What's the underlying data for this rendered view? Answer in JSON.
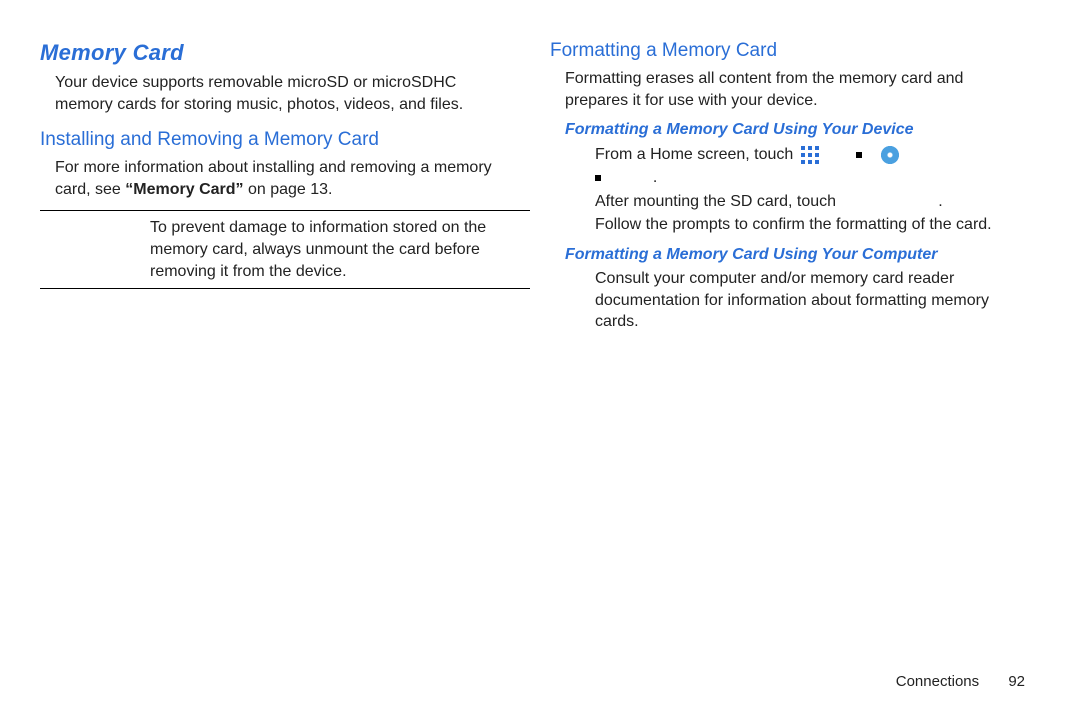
{
  "left": {
    "title": "Memory Card",
    "intro": "Your device supports removable microSD or microSDHC memory cards for storing music, photos, videos, and files.",
    "install_title": "Installing and Removing a Memory Card",
    "install_lead": "For more information about installing and removing a memory card, see ",
    "install_bold": "“Memory Card”",
    "install_tail": " on page 13.",
    "note": "To prevent damage to information stored on the memory card, always unmount the card before removing it from the device."
  },
  "right": {
    "title": "Formatting a Memory Card",
    "intro": "Formatting erases all content from the memory card and prepares it for use with your device.",
    "m1_title": "Formatting a Memory Card Using Your Device",
    "m1_step_lead_a": "From a Home screen, touch ",
    "m1_step_tail_a": ".",
    "m1_step_lead_b": "After mounting the SD card, touch ",
    "m1_step_tail_b": ".",
    "m1_step_c": "Follow the prompts to confirm the formatting of the card.",
    "m2_title": "Formatting a Memory Card Using Your Computer",
    "m2_body": "Consult your computer and/or memory card reader documentation for information about formatting memory cards."
  },
  "footer": {
    "section": "Connections",
    "page": "92"
  }
}
